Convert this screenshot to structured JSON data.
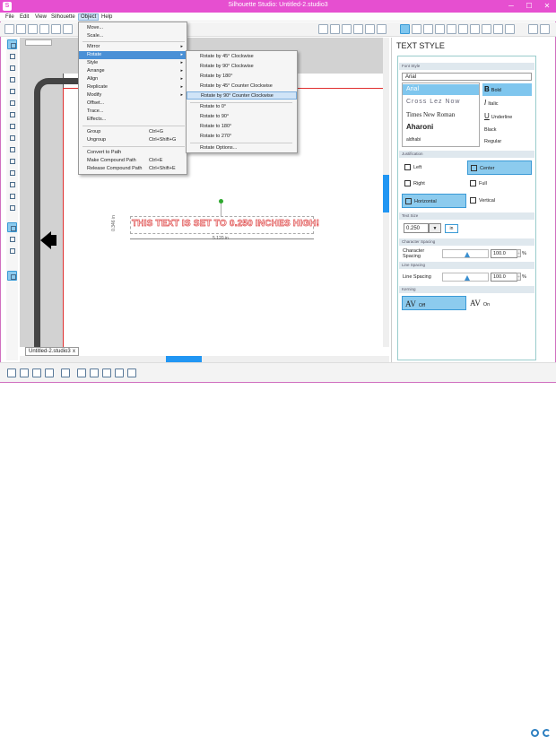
{
  "window": {
    "title": "Silhouette Studio: Untitled-2.studio3",
    "min": "─",
    "max": "☐",
    "close": "✕",
    "app_icon": "S"
  },
  "menubar": [
    "File",
    "Edit",
    "View",
    "Silhouette",
    "Object",
    "Help"
  ],
  "object_menu": {
    "items": [
      {
        "label": "Move...",
        "shortcut": "",
        "submenu": false
      },
      {
        "label": "Scale...",
        "shortcut": "",
        "submenu": false
      },
      {
        "label": "Mirror",
        "shortcut": "",
        "submenu": true
      },
      {
        "label": "Rotate",
        "shortcut": "",
        "submenu": true
      },
      {
        "label": "Style",
        "shortcut": "",
        "submenu": true
      },
      {
        "label": "Arrange",
        "shortcut": "",
        "submenu": true
      },
      {
        "label": "Align",
        "shortcut": "",
        "submenu": true
      },
      {
        "label": "Replicate",
        "shortcut": "",
        "submenu": true
      },
      {
        "label": "Modify",
        "shortcut": "",
        "submenu": true
      },
      {
        "label": "Offset...",
        "shortcut": "",
        "submenu": false
      },
      {
        "label": "Trace...",
        "shortcut": "",
        "submenu": false
      },
      {
        "label": "Effects...",
        "shortcut": "",
        "submenu": false
      },
      {
        "label": "Group",
        "shortcut": "Ctrl+G",
        "submenu": false
      },
      {
        "label": "Ungroup",
        "shortcut": "Ctrl+Shift+G",
        "submenu": false
      },
      {
        "label": "Convert to Path",
        "shortcut": "",
        "submenu": false
      },
      {
        "label": "Make Compound Path",
        "shortcut": "Ctrl+E",
        "submenu": false
      },
      {
        "label": "Release Compound Path",
        "shortcut": "Ctrl+Shift+E",
        "submenu": false
      }
    ],
    "arrow": "▸"
  },
  "rotate_submenu": [
    "Rotate by 45° Clockwise",
    "Rotate by 90° Clockwise",
    "Rotate by 180°",
    "Rotate by 45° Counter Clockwise",
    "Rotate by 90° Counter Clockwise",
    "Rotate to 0°",
    "Rotate to 90°",
    "Rotate to 180°",
    "Rotate to 270°",
    "Rotate Options..."
  ],
  "canvas": {
    "text": "THIS TEXT IS SET TO 0.250 INCHES HIGH!",
    "width_label": "5.120 in",
    "height_label": "0.346 in",
    "doc_tab": "Untitled-2.studio3",
    "doc_tab_close": "x"
  },
  "panel": {
    "title": "TEXT STYLE",
    "font_style_label": "Font Style",
    "font_name": "Arial",
    "fonts": [
      "Arial",
      "Cross Lez Now",
      "Times New Roman",
      "Aharoni",
      "aldhabi"
    ],
    "styles": [
      "Bold",
      "Italic",
      "Underline",
      "Black",
      "Regular"
    ],
    "justification_label": "Justification",
    "justify": [
      "Left",
      "Center",
      "Right",
      "Full"
    ],
    "orientation": [
      "Horizontal",
      "Vertical"
    ],
    "text_size_label": "Text Size",
    "text_size": "0.250",
    "text_size_drop": "▼",
    "text_unit": "in",
    "char_spacing_section": "Character Spacing",
    "char_spacing_label": "Character Spacing",
    "char_spacing_value": "100.0",
    "line_spacing_section": "Line Spacing",
    "line_spacing_label": "Line Spacing",
    "line_spacing_value": "100.0",
    "pct": "%",
    "spin": "÷",
    "kerning_label": "Kerning",
    "kerning": [
      "Off",
      "On"
    ]
  }
}
